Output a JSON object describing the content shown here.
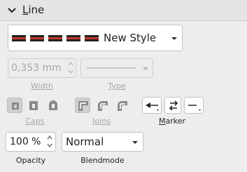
{
  "section": {
    "title_accel": "L",
    "title_rest": "ine"
  },
  "line_style": {
    "value": "New Style"
  },
  "width": {
    "value": "0,353 mm",
    "label": "Width"
  },
  "type": {
    "label": "Type"
  },
  "caps": {
    "label": "Caps"
  },
  "joins": {
    "label": "Joins"
  },
  "marker": {
    "label_accel": "M",
    "label_rest": "arker"
  },
  "opacity": {
    "value": "100 %",
    "label": "Opacity"
  },
  "blendmode": {
    "value": "Normal",
    "label": "Blendmode"
  },
  "colors": {
    "disabled_text": "#a8a8a8",
    "line_red": "#c0392b",
    "line_dark": "#222222"
  }
}
